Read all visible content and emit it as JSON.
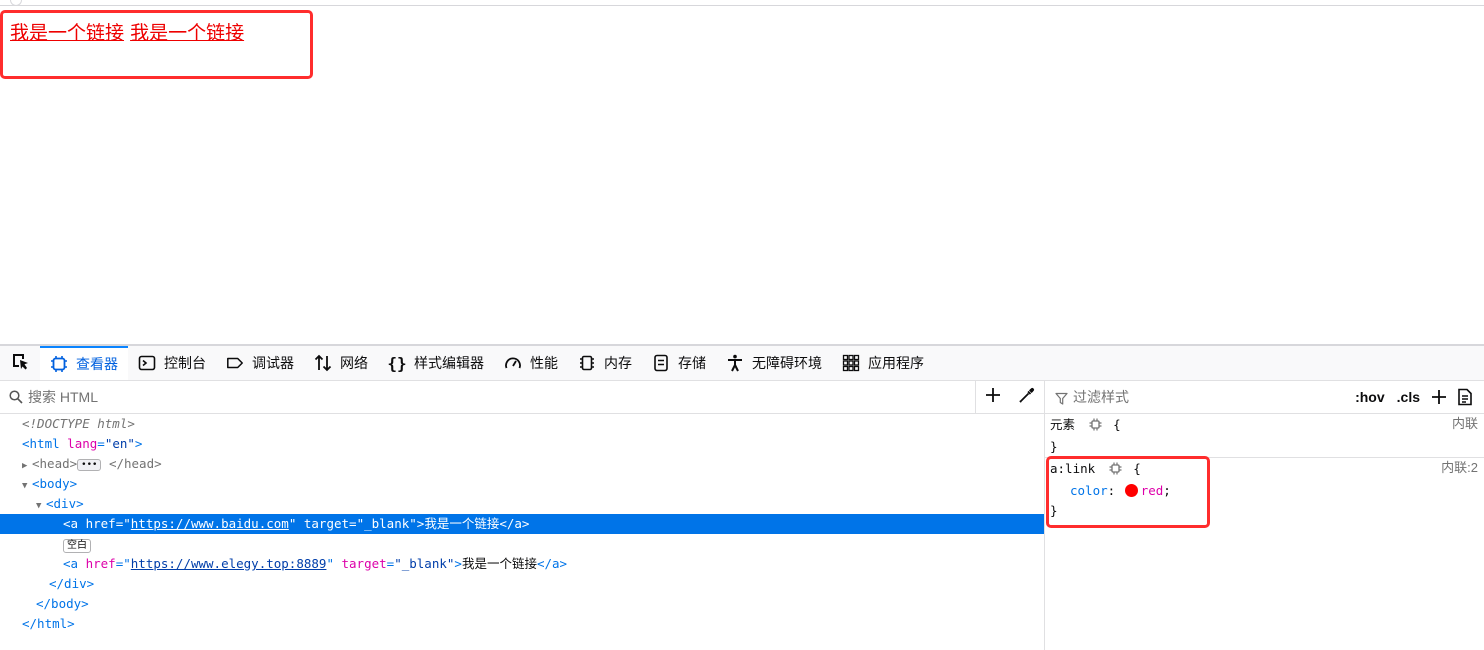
{
  "page": {
    "links": [
      {
        "text": "我是一个链接",
        "href": "https://www.baidu.com"
      },
      {
        "text": "我是一个链接",
        "href": "https://www.elegy.top:8889"
      }
    ],
    "link_color": "#ee0000"
  },
  "devtools": {
    "tabs": [
      {
        "label": "查看器",
        "icon": "inspector-icon",
        "active": true
      },
      {
        "label": "控制台",
        "icon": "console-icon"
      },
      {
        "label": "调试器",
        "icon": "debugger-icon"
      },
      {
        "label": "网络",
        "icon": "network-icon"
      },
      {
        "label": "样式编辑器",
        "icon": "style-editor-icon"
      },
      {
        "label": "性能",
        "icon": "performance-icon"
      },
      {
        "label": "内存",
        "icon": "memory-icon"
      },
      {
        "label": "存储",
        "icon": "storage-icon"
      },
      {
        "label": "无障碍环境",
        "icon": "accessibility-icon"
      },
      {
        "label": "应用程序",
        "icon": "application-icon"
      }
    ],
    "markup": {
      "search_placeholder": "搜索 HTML",
      "doctype": "<!DOCTYPE html>",
      "html_open": "<html",
      "html_attr": "lang",
      "html_attr_val": "\"en\"",
      "head": "<head>",
      "head_close": "</head>",
      "body_open": "<body>",
      "div_open": "<div>",
      "a1": {
        "open": "<a",
        "href_attr": "href",
        "href": "https://www.baidu.com",
        "target_attr": "target",
        "target": "\"_blank\"",
        "text": "我是一个链接",
        "close": "</a>"
      },
      "whitespace_badge": "空白",
      "a2": {
        "open": "<a",
        "href_attr": "href",
        "href": "https://www.elegy.top:8889",
        "target_attr": "target",
        "target": "\"_blank\"",
        "text": "我是一个链接",
        "close": "</a>"
      },
      "div_close": "</div>",
      "body_close": "</body>",
      "html_close": "</html>"
    },
    "rules": {
      "filter_placeholder": "过滤样式",
      "hov_label": ":hov",
      "cls_label": ".cls",
      "element_rule": {
        "selector": "元素",
        "open": "{",
        "close": "}",
        "source": "内联"
      },
      "link_rule": {
        "selector": "a:link",
        "open": "{",
        "property": "color",
        "value": "red",
        "swatch_color": "#ff0000",
        "close": "}",
        "source": "内联:2"
      }
    }
  },
  "colors": {
    "accent": "#0a84ff",
    "selected_row": "#0074e8",
    "annotation_box": "#ff2d2d"
  }
}
